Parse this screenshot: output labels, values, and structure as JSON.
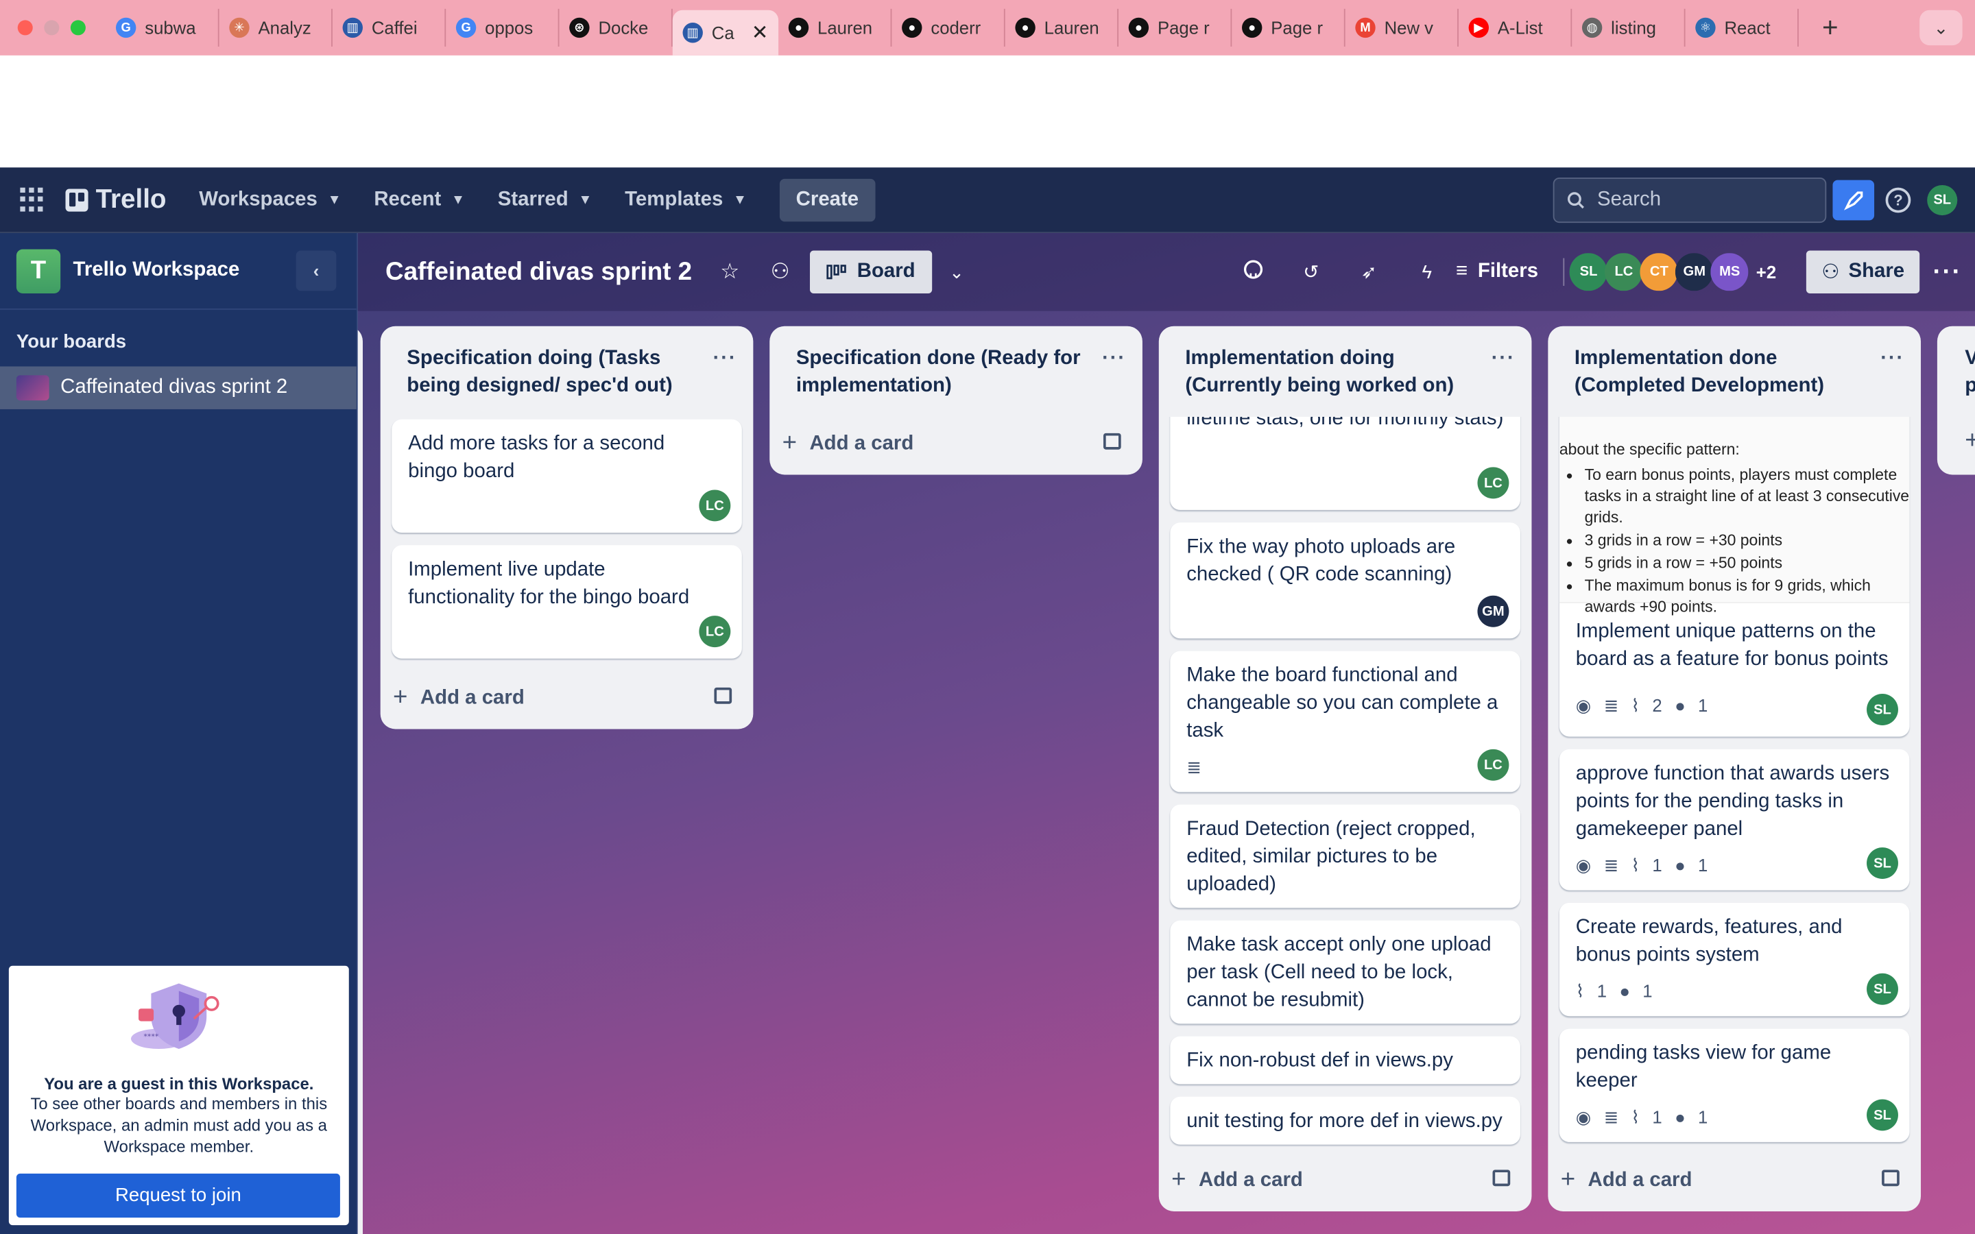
{
  "browser": {
    "tabs": [
      {
        "title": "subwa",
        "icon": "google-icon",
        "color": "#4285f4"
      },
      {
        "title": "Analyz",
        "icon": "claude-icon",
        "color": "#d97757"
      },
      {
        "title": "Caffei",
        "icon": "trello-icon",
        "color": "#2b5aa8"
      },
      {
        "title": "oppos",
        "icon": "google-icon",
        "color": "#4285f4"
      },
      {
        "title": "Docke",
        "icon": "openai-icon",
        "color": "#111111"
      },
      {
        "title": "Ca",
        "icon": "trello-icon",
        "color": "#2b5aa8",
        "active": true
      },
      {
        "title": "Lauren",
        "icon": "github-icon",
        "color": "#111111"
      },
      {
        "title": "coderr",
        "icon": "github-icon",
        "color": "#111111"
      },
      {
        "title": "Lauren",
        "icon": "github-icon",
        "color": "#111111"
      },
      {
        "title": "Page r",
        "icon": "github-icon",
        "color": "#111111"
      },
      {
        "title": "Page r",
        "icon": "github-icon",
        "color": "#111111"
      },
      {
        "title": "New v",
        "icon": "gmail-icon",
        "color": "#ea4335"
      },
      {
        "title": "A-List",
        "icon": "youtube-icon",
        "color": "#ff0000"
      },
      {
        "title": "listing",
        "icon": "globe-icon",
        "color": "#666666"
      },
      {
        "title": "React",
        "icon": "react-icon",
        "color": "#2b6cb0"
      }
    ]
  },
  "header": {
    "logo": "Trello",
    "nav": [
      "Workspaces",
      "Recent",
      "Starred",
      "Templates"
    ],
    "create": "Create",
    "search_placeholder": "Search",
    "user_initials": "SL"
  },
  "sidebar": {
    "workspace_initial": "T",
    "workspace_name": "Trello Workspace",
    "your_boards": "Your boards",
    "board_name": "Caffeinated divas sprint 2",
    "guest_title": "You are a guest in this Workspace.",
    "guest_body": "To see other boards and members in this Workspace, an admin must add you as a Workspace member.",
    "request_button": "Request to join"
  },
  "board": {
    "title": "Caffeinated divas sprint 2",
    "view": "Board",
    "filters": "Filters",
    "members": [
      "SL",
      "LC",
      "CT",
      "GM",
      "MS"
    ],
    "extra_members": "+2",
    "share": "Share",
    "add_card": "Add a card"
  },
  "lists": {
    "spec_doing": {
      "title": "Specification doing (Tasks being designed/ spec'd out)",
      "cards": [
        {
          "text": "Add more tasks for a second bingo board",
          "member": "LC"
        },
        {
          "text": "Implement live update functionality for the bingo board",
          "member": "LC"
        }
      ]
    },
    "spec_done": {
      "title": "Specification done (Ready for implementation)"
    },
    "impl_doing": {
      "title": "Implementation doing (Currently being worked on)",
      "cards": [
        {
          "text": "lifetime stats, one for monthly stats)",
          "member": "LC"
        },
        {
          "text": "Fix the way photo uploads are checked ( QR code scanning)",
          "member": "GM"
        },
        {
          "text": "Make the board functional and changeable so you can complete a task",
          "member": "LC"
        },
        {
          "text": "Fraud Detection (reject cropped, edited, similar pictures to be uploaded)"
        },
        {
          "text": "Make task accept only one upload per task (Cell need to be lock, cannot be resubmit)"
        },
        {
          "text": "Fix non-robust def in views.py"
        },
        {
          "text": "unit testing for more def in views.py"
        }
      ]
    },
    "impl_done": {
      "title": "Implementation done (Completed Development)",
      "cover_intro": "about the specific pattern:",
      "cover_bullets": [
        "To earn bonus points, players must complete tasks in a straight line of at least 3 consecutive grids.",
        "3 grids in a row = +30 points",
        "5 grids in a row = +50 points",
        "The maximum bonus is for 9 grids, which awards +90 points."
      ],
      "cards": [
        {
          "text": "Implement unique patterns on the board as a feature for bonus points",
          "attachments": "2",
          "github": "1",
          "member": "SL"
        },
        {
          "text": "approve function that awards users points for the pending tasks in gamekeeper panel",
          "attachments": "1",
          "github": "1",
          "member": "SL"
        },
        {
          "text": "Create rewards, features, and bonus points system",
          "attachments": "1",
          "github": "1",
          "member": "SL"
        },
        {
          "text": "pending tasks view for game keeper",
          "attachments": "1",
          "github": "1",
          "member": "SL"
        }
      ]
    },
    "next_partial": {
      "title": "V p"
    }
  }
}
